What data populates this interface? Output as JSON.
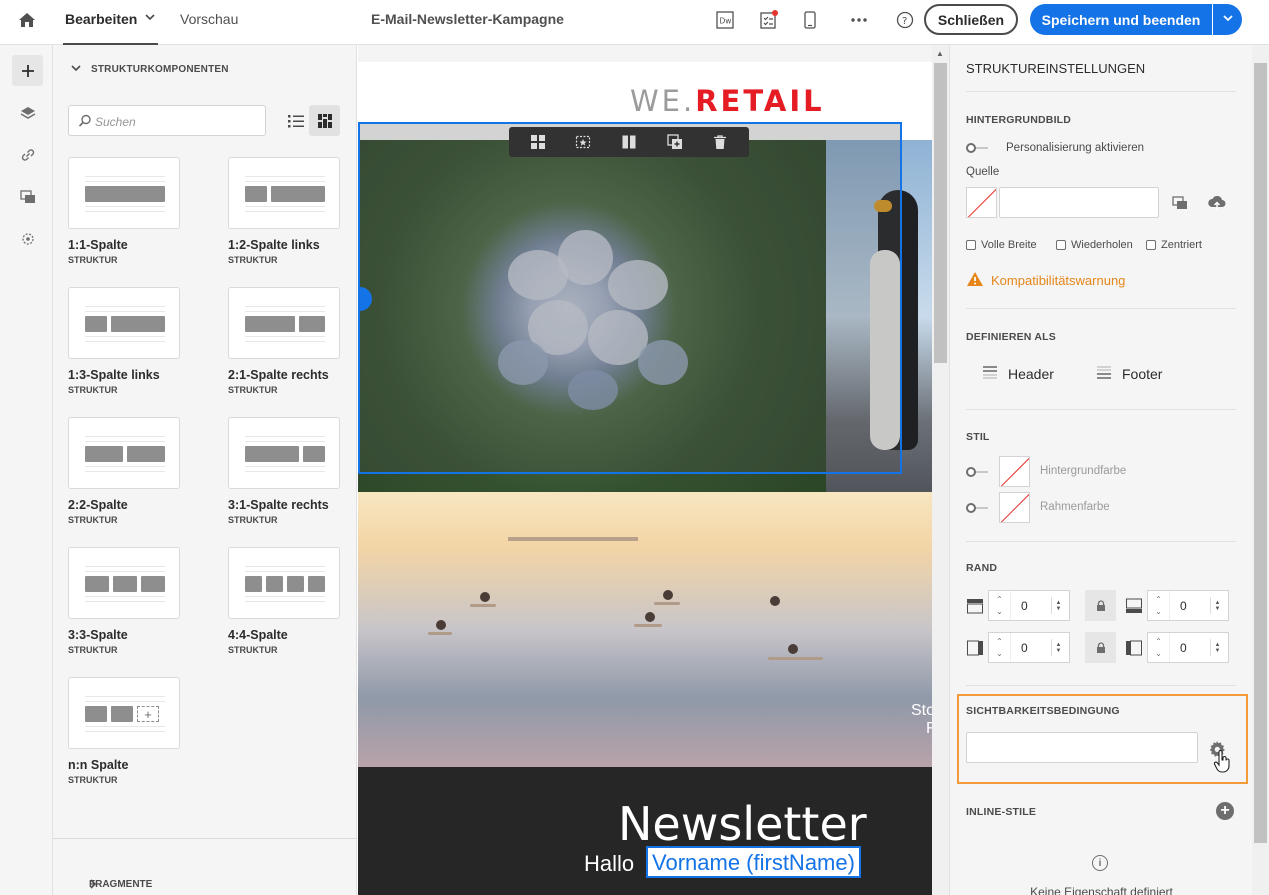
{
  "header": {
    "tab_edit": "Bearbeiten",
    "tab_preview": "Vorschau",
    "title": "E-Mail-Newsletter-Kampagne",
    "close_label": "Schließen",
    "save_label": "Speichern und beenden",
    "icons": [
      "home-icon",
      "dreamweaver-icon",
      "checklist-icon",
      "mobile-preview-icon",
      "more-icon",
      "help-icon"
    ],
    "accent": "#1473e6"
  },
  "rail": {
    "items": [
      "add-icon",
      "layers-icon",
      "link-icon",
      "assets-icon",
      "personalization-icon"
    ]
  },
  "components": {
    "section_title": "STRUKTURKOMPONENTEN",
    "search_placeholder": "Suchen",
    "items": [
      {
        "name": "1:1-Spalte",
        "type": "STRUKTUR"
      },
      {
        "name": "1:2-Spalte links",
        "type": "STRUKTUR"
      },
      {
        "name": "1:3-Spalte links",
        "type": "STRUKTUR"
      },
      {
        "name": "2:1-Spalte rechts",
        "type": "STRUKTUR"
      },
      {
        "name": "2:2-Spalte",
        "type": "STRUKTUR"
      },
      {
        "name": "3:1-Spalte rechts",
        "type": "STRUKTUR"
      },
      {
        "name": "3:3-Spalte",
        "type": "STRUKTUR"
      },
      {
        "name": "4:4-Spalte",
        "type": "STRUKTUR"
      },
      {
        "name": "n:n Spalte",
        "type": "STRUKTUR"
      }
    ],
    "fragments_title": "FRAGMENTE"
  },
  "email": {
    "logo_prefix": "WE.",
    "logo_brand": "RETAIL",
    "logo_color": "#e51c23",
    "caption_line1": "Sto",
    "caption_line2": "F",
    "newsletter_title": "Newsletter",
    "greeting": "Hallo",
    "personalization_field": "Vorname (firstName)"
  },
  "settings": {
    "title": "STRUKTUREINSTELLUNGEN",
    "background_image": {
      "section": "HINTERGRUNDBILD",
      "personalization_toggle": "Personalisierung aktivieren",
      "source_label": "Quelle",
      "source_value": "",
      "checkbox_full_width": "Volle Breite",
      "checkbox_repeat": "Wiederholen",
      "checkbox_centered": "Zentriert",
      "warning": "Kompatibilitätswarnung",
      "warning_color": "#e68619"
    },
    "define_as": {
      "section": "DEFINIEREN ALS",
      "header": "Header",
      "footer": "Footer"
    },
    "style": {
      "section": "STIL",
      "background_color": "Hintergrundfarbe",
      "border_color": "Rahmenfarbe"
    },
    "margin": {
      "section": "RAND",
      "top": "0",
      "bottom": "0",
      "left": "0",
      "right": "0"
    },
    "visibility": {
      "section": "SICHTBARKEITSBEDINGUNG",
      "value": "",
      "highlight_color": "#f29b38"
    },
    "inline_styles": {
      "section": "INLINE-STILE",
      "empty_text": "Keine Eigenschaft definiert"
    }
  }
}
